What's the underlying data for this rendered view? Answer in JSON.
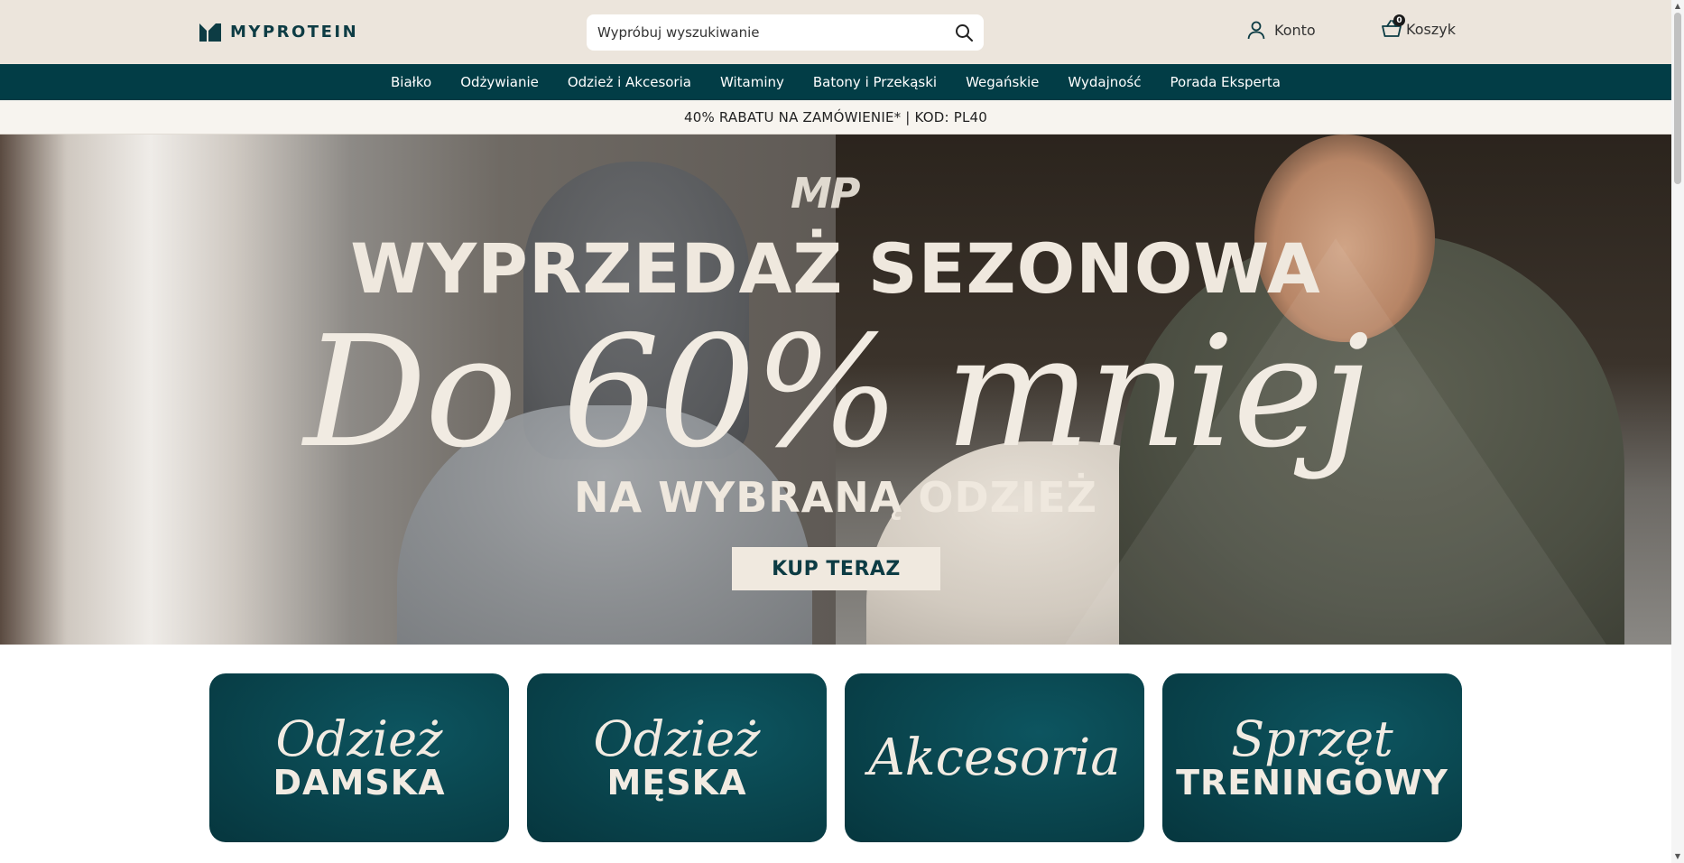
{
  "header": {
    "logo_text": "MYPROTEIN",
    "search_placeholder": "Wypróbuj wyszukiwanie",
    "account_label": "Konto",
    "cart_label": "Koszyk",
    "cart_count": "0"
  },
  "nav": {
    "items": [
      {
        "label": "Białko"
      },
      {
        "label": "Odżywianie"
      },
      {
        "label": "Odzież i Akcesoria"
      },
      {
        "label": "Witaminy"
      },
      {
        "label": "Batony i Przekąski"
      },
      {
        "label": "Wegańskie"
      },
      {
        "label": "Wydajność"
      },
      {
        "label": "Porada Eksperta"
      }
    ]
  },
  "promo": {
    "text": "40% RABATU NA ZAMÓWIENIE* | KOD: PL40"
  },
  "hero": {
    "brand_mark": "MP",
    "title": "WYPRZEDAŻ SEZONOWA",
    "headline": "Do 60% mniej",
    "subtitle": "NA WYBRANĄ ODZIEŻ",
    "cta_label": "KUP TERAZ"
  },
  "categories": [
    {
      "script": "Odzież",
      "caps": "DAMSKA"
    },
    {
      "script": "Odzież",
      "caps": "MĘSKA"
    },
    {
      "script": "Akcesoria",
      "caps": ""
    },
    {
      "script": "Sprzęt",
      "caps": "TRENINGOWY"
    }
  ],
  "colors": {
    "nav_bg": "#023d46",
    "header_bg": "#ece5dc",
    "brand": "#0d3c44",
    "card_bg": "#0a4750"
  }
}
